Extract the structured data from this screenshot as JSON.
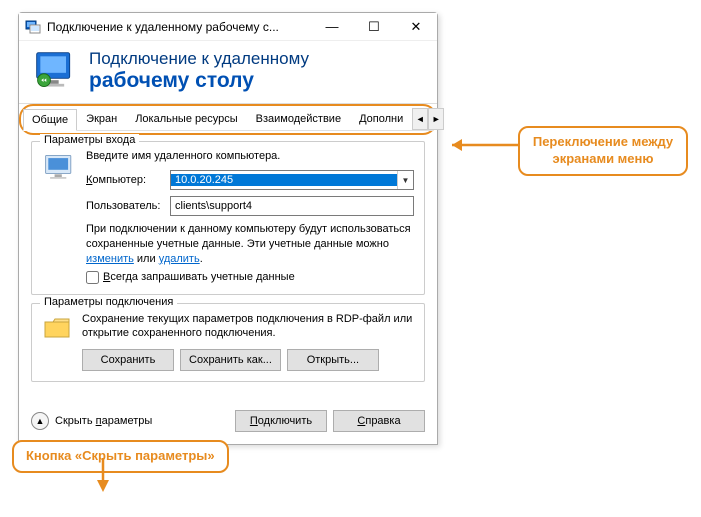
{
  "titlebar": {
    "text": "Подключение к удаленному рабочему с..."
  },
  "header": {
    "line1": "Подключение к удаленному",
    "line2": "рабочему столу"
  },
  "tabs": {
    "items": [
      "Общие",
      "Экран",
      "Локальные ресурсы",
      "Взаимодействие",
      "Дополни"
    ],
    "active_index": 0
  },
  "login_group": {
    "title": "Параметры входа",
    "intro": "Введите имя удаленного компьютера.",
    "computer_label": "Компьютер:",
    "computer_value": "10.0.20.245",
    "user_label": "Пользователь:",
    "user_value": "clients\\support4",
    "saved_note_1": "При подключении к данному компьютеру будут использоваться сохраненные учетные данные.  Эти учетные данные можно ",
    "saved_link_edit": "изменить",
    "saved_or": " или ",
    "saved_link_delete": "удалить",
    "saved_end": ".",
    "checkbox": "Всегда запрашивать учетные данные"
  },
  "conn_group": {
    "title": "Параметры подключения",
    "text": "Сохранение текущих параметров подключения в RDP-файл или открытие сохраненного подключения.",
    "save": "Сохранить",
    "save_as": "Сохранить как...",
    "open": "Открыть..."
  },
  "footer": {
    "hide": "Скрыть параметры",
    "connect": "Подключить",
    "help": "Справка"
  },
  "callouts": {
    "tabs": "Переключение между экранами меню",
    "hide": "Кнопка «Скрыть параметры»"
  }
}
